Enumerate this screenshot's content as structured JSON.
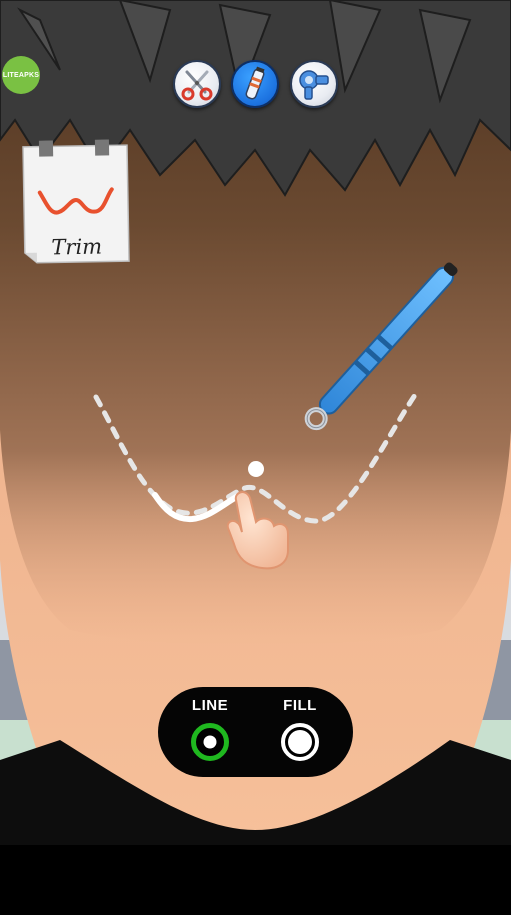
{
  "badge": {
    "text": "LITEAPKS",
    "color": "#7ac143"
  },
  "tools": [
    {
      "name": "scissors",
      "icon": "scissors-icon",
      "active": false
    },
    {
      "name": "trimmer",
      "icon": "trimmer-icon",
      "active": true
    },
    {
      "name": "hair-dryer",
      "icon": "hair-dryer-icon",
      "active": false
    }
  ],
  "task_note": {
    "label": "Trim",
    "pattern": "wave-pattern",
    "accent": "#e8512e"
  },
  "modes": {
    "line": {
      "label": "LINE",
      "selected": true,
      "accent": "#1fb81f"
    },
    "fill": {
      "label": "FILL",
      "selected": false
    }
  },
  "colors": {
    "active_tool": "#1c72e0",
    "skin": "#f2b48e",
    "hair": "#6b4a31",
    "trimmer": "#3d9ae6"
  }
}
